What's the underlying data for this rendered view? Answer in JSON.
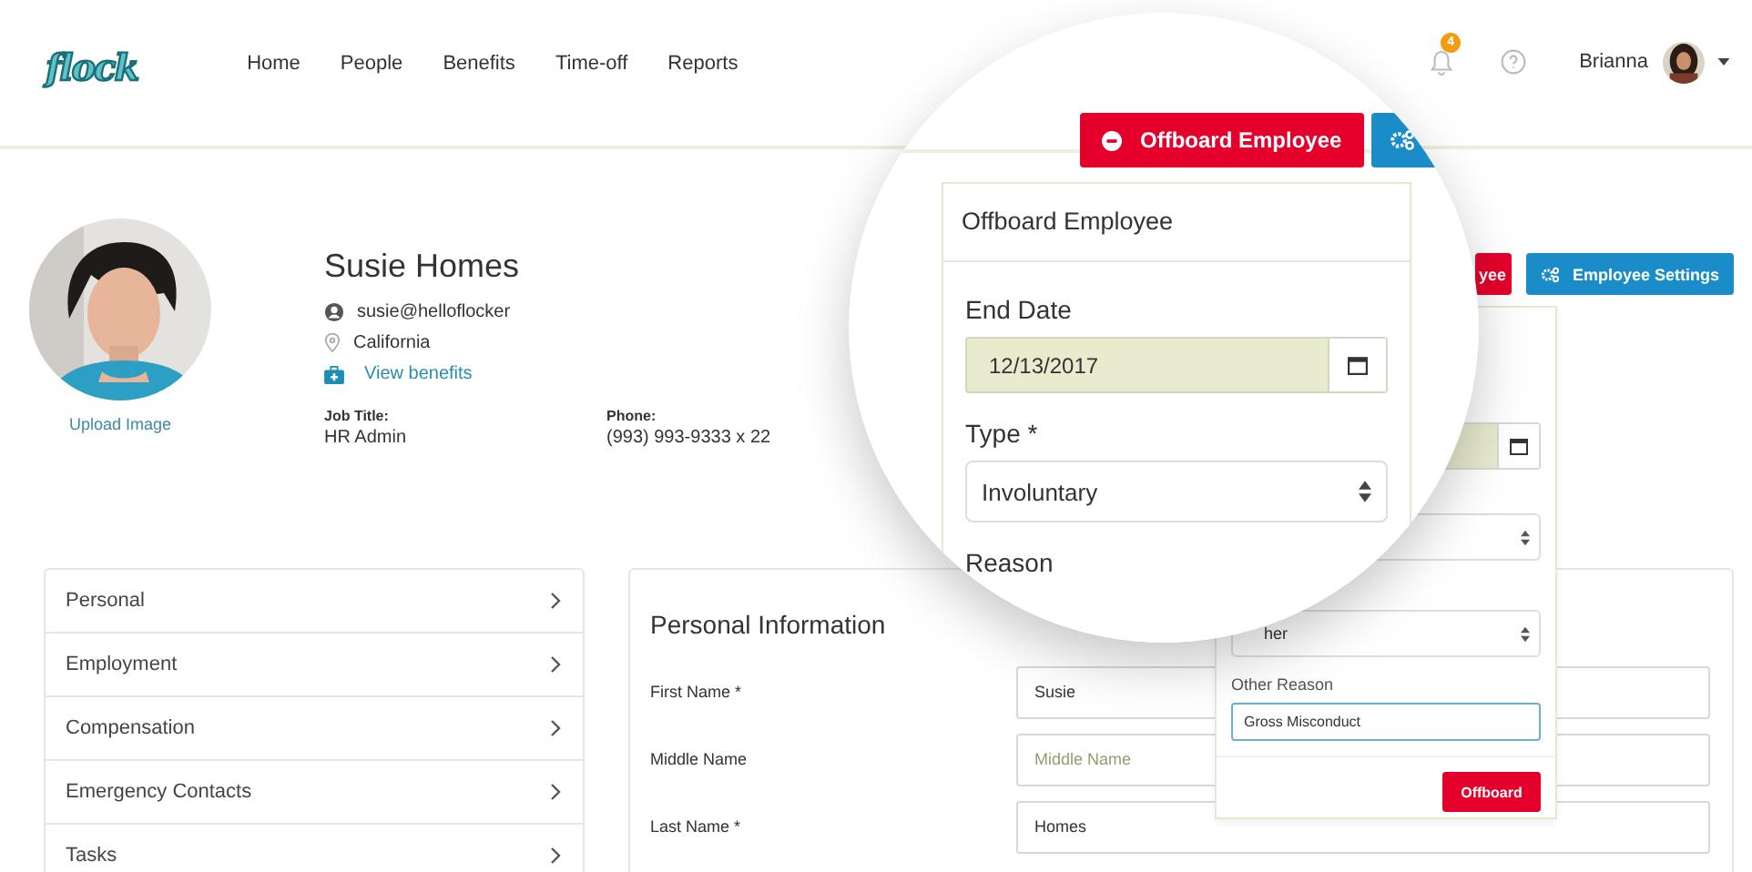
{
  "header": {
    "logo": "flock",
    "nav": [
      {
        "label": "Home"
      },
      {
        "label": "People"
      },
      {
        "label": "Benefits"
      },
      {
        "label": "Time-off"
      },
      {
        "label": "Reports"
      }
    ],
    "notifications": {
      "count": "4"
    },
    "user": {
      "name": "Brianna"
    }
  },
  "profile": {
    "upload_label": "Upload Image",
    "name": "Susie Homes",
    "email": "susie@helloflocker",
    "location": "California",
    "benefits_link": "View benefits",
    "fields": [
      {
        "label": "Job Title:",
        "value": "HR Admin"
      },
      {
        "label": "Phone:",
        "value": "(993) 993-9333 x 22"
      }
    ]
  },
  "actions": [
    {
      "kind": "danger",
      "label": "yee"
    },
    {
      "kind": "primary",
      "label": "Employee Settings"
    }
  ],
  "sections": [
    {
      "label": "Personal"
    },
    {
      "label": "Employment"
    },
    {
      "label": "Compensation"
    },
    {
      "label": "Emergency Contacts"
    },
    {
      "label": "Tasks"
    }
  ],
  "personal_info": {
    "title": "Personal Information",
    "fields": [
      {
        "label": "First Name *",
        "value": "Susie"
      },
      {
        "label": "Middle Name",
        "placeholder": "Middle Name"
      },
      {
        "label": "Last Name *",
        "value": "Homes"
      }
    ]
  },
  "offboard_popover": {
    "reason_value": "her",
    "other_reason_label": "Other Reason",
    "other_reason_value": "Gross Misconduct",
    "submit": "Offboard"
  },
  "magnifier": {
    "offboard_button": "Offboard Employee",
    "popover_title": "Offboard Employee",
    "end_date_label": "End Date",
    "end_date_value": "12/13/2017",
    "type_label": "Type *",
    "type_value": "Involuntary",
    "reason_label": "Reason"
  }
}
